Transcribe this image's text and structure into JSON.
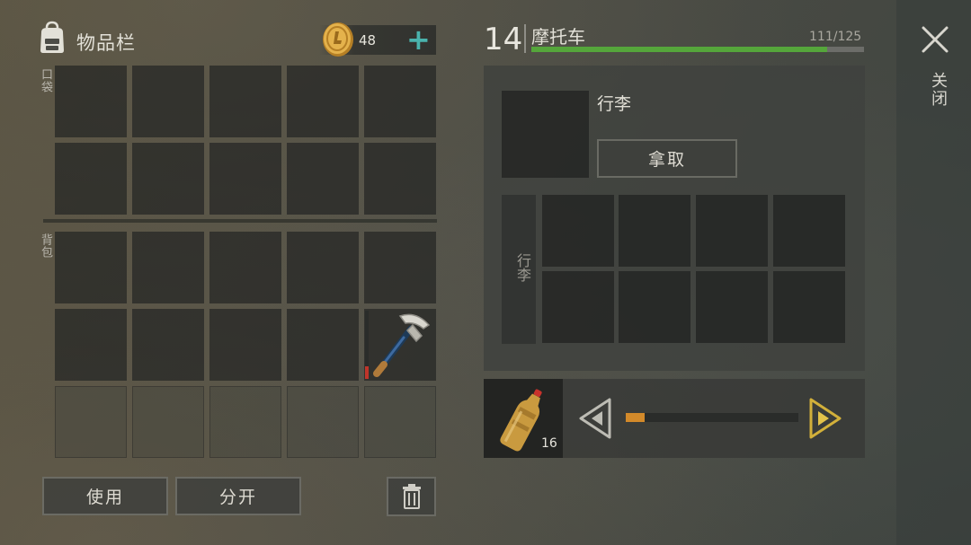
{
  "inventory": {
    "title": "物品栏",
    "coins": "48",
    "plus_symbol": "+",
    "pocket_label": "口袋",
    "backpack_label": "背包",
    "pocket_rows": 2,
    "backpack_rows": 2,
    "locked_rows": 1,
    "columns": 5,
    "pickaxe_slot": {
      "row": 1,
      "col": 4,
      "icon": "pickaxe-icon"
    }
  },
  "actions": {
    "use": "使用",
    "split": "分开",
    "trash_icon": "trash-icon"
  },
  "vehicle": {
    "level": "14",
    "name": "摩托车",
    "durability_text": "111/125",
    "durability_fraction": 0.888,
    "colors": {
      "durability": "#55a63b"
    }
  },
  "cargo": {
    "name": "行李",
    "take_button": "拿取",
    "side_label": "行李",
    "rows": 2,
    "columns": 4
  },
  "fuel": {
    "icon": "fuel-bottle-icon",
    "count": "16",
    "slider_fraction": 0.11,
    "colors": {
      "slider": "#d38a2a",
      "right_arrow": "#d2b03a"
    }
  },
  "close": {
    "label": "关闭"
  }
}
